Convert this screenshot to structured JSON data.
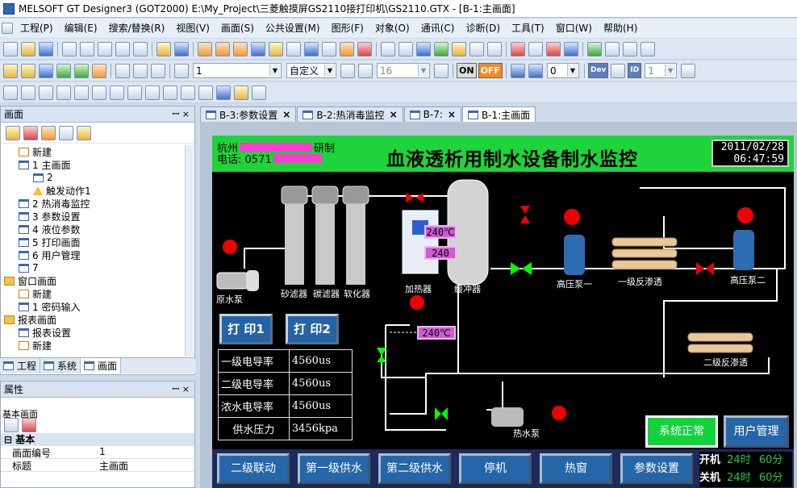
{
  "window": {
    "title": "MELSOFT GT Designer3 (GOT2000) E:\\My_Project\\三菱触摸屏GS2110接打印机\\GS2110.GTX - [B-1:主画面]"
  },
  "menu": [
    "工程(P)",
    "编辑(E)",
    "搜索/替换(R)",
    "视图(V)",
    "画面(S)",
    "公共设置(M)",
    "图形(F)",
    "对象(O)",
    "通讯(C)",
    "诊断(D)",
    "工具(T)",
    "窗口(W)",
    "帮助(H)"
  ],
  "toolbar": {
    "zoom_value": "1",
    "layer_value": "自定义",
    "font_size": "16",
    "arrow_value": "0",
    "id_value": "1",
    "on_label": "ON",
    "off_label": "OFF",
    "dev_label": "Dev",
    "id_label": "ID"
  },
  "left_panel": {
    "header": "画面",
    "pin": "ꟷ ×",
    "tree": [
      {
        "label": "新建",
        "icon": "new",
        "indent": 1
      },
      {
        "label": "1 主画面",
        "icon": "page",
        "indent": 1
      },
      {
        "label": "2",
        "icon": "doc",
        "indent": 2
      },
      {
        "label": "触发动作1",
        "icon": "warn",
        "indent": 2
      },
      {
        "label": "2 热消毒监控",
        "icon": "page",
        "indent": 1
      },
      {
        "label": "3 参数设置",
        "icon": "page",
        "indent": 1
      },
      {
        "label": "4 液位参数",
        "icon": "page",
        "indent": 1
      },
      {
        "label": "5 打印画面",
        "icon": "page",
        "indent": 1
      },
      {
        "label": "6 用户管理",
        "icon": "page",
        "indent": 1
      },
      {
        "label": "7",
        "icon": "page",
        "indent": 1
      },
      {
        "label": "窗口画面",
        "icon": "folder",
        "indent": 0
      },
      {
        "label": "新建",
        "icon": "new",
        "indent": 1
      },
      {
        "label": "1 密码输入",
        "icon": "page",
        "indent": 1
      },
      {
        "label": "报表画面",
        "icon": "folder",
        "indent": 0
      },
      {
        "label": "报表设置",
        "icon": "page",
        "indent": 1
      },
      {
        "label": "新建",
        "icon": "new",
        "indent": 1
      }
    ],
    "bottom_tabs": [
      "工程",
      "系统",
      "画面"
    ]
  },
  "properties": {
    "header": "属性",
    "target": "基本画面",
    "section": "基本",
    "rows": [
      {
        "key": "画面编号",
        "value": "1"
      },
      {
        "key": "标题",
        "value": "主画面"
      }
    ]
  },
  "doc_tabs": [
    "B-3:参数设置",
    "B-2:热消毒监控",
    "B-7:",
    "B-1:主画面"
  ],
  "hmi": {
    "company": "杭州",
    "company_tail": "研制",
    "phone": "电话:  0571",
    "title": "血液透析用制水设备制水监控",
    "date": "2011/02/28",
    "time": "06:47:59",
    "print1": "打 印1",
    "print2": "打 印2",
    "table": [
      {
        "label": "一级电导率",
        "value": "4560us"
      },
      {
        "label": "二级电导率",
        "value": "4560us"
      },
      {
        "label": "浓水电导率",
        "value": "4560us"
      },
      {
        "label": "供水压力",
        "value": "3456kpa"
      }
    ],
    "temp1": "240℃",
    "temp2": "240",
    "temp3": "240℃",
    "labels": {
      "raw_pump": "原水泵",
      "sand": "砂滤器",
      "carbon": "碳滤器",
      "softener": "软化器",
      "heater": "加热器",
      "buffer": "缓冲器",
      "hp1": "高压泵一",
      "ro1": "一级反渗透",
      "hp2": "高压泵二",
      "ro2": "二级反渗透",
      "hot_pump": "热水泵"
    },
    "status_btn": "系统正常",
    "user_btn": "用户管理",
    "bottom_buttons": [
      "二级联动",
      "第一级供水",
      "第二级供水",
      "停机",
      "热窗",
      "参数设置"
    ],
    "on_label": "开机",
    "off_label": "关机",
    "on_hours": "24时",
    "on_mins": "60分",
    "off_hours": "24时",
    "off_mins": "60分"
  }
}
